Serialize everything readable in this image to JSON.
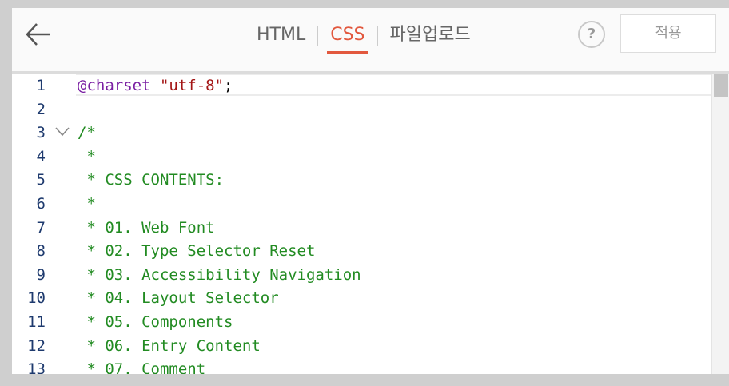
{
  "header": {
    "tabs": [
      {
        "label": "HTML",
        "active": false
      },
      {
        "label": "CSS",
        "active": true
      },
      {
        "label": "파일업로드",
        "active": false
      }
    ],
    "help_label": "?",
    "apply_label": "적용"
  },
  "editor": {
    "lines": [
      {
        "n": "1",
        "parts": [
          {
            "t": "@charset",
            "c": "kw"
          },
          {
            "t": " ",
            "c": ""
          },
          {
            "t": "\"utf-8\"",
            "c": "str"
          },
          {
            "t": ";",
            "c": ""
          }
        ]
      },
      {
        "n": "2",
        "parts": []
      },
      {
        "n": "3",
        "parts": [
          {
            "t": "/*",
            "c": "comment"
          }
        ]
      },
      {
        "n": "4",
        "parts": [
          {
            "t": " *",
            "c": "comment"
          }
        ]
      },
      {
        "n": "5",
        "parts": [
          {
            "t": " * CSS CONTENTS:",
            "c": "comment"
          }
        ]
      },
      {
        "n": "6",
        "parts": [
          {
            "t": " *",
            "c": "comment"
          }
        ]
      },
      {
        "n": "7",
        "parts": [
          {
            "t": " * 01. Web Font",
            "c": "comment"
          }
        ]
      },
      {
        "n": "8",
        "parts": [
          {
            "t": " * 02. Type Selector Reset",
            "c": "comment"
          }
        ]
      },
      {
        "n": "9",
        "parts": [
          {
            "t": " * 03. Accessibility Navigation",
            "c": "comment"
          }
        ]
      },
      {
        "n": "10",
        "parts": [
          {
            "t": " * 04. Layout Selector",
            "c": "comment"
          }
        ]
      },
      {
        "n": "11",
        "parts": [
          {
            "t": " * 05. Components",
            "c": "comment"
          }
        ]
      },
      {
        "n": "12",
        "parts": [
          {
            "t": " * 06. Entry Content",
            "c": "comment"
          }
        ]
      },
      {
        "n": "13",
        "parts": [
          {
            "t": " * 07. Comment",
            "c": "comment"
          }
        ]
      }
    ],
    "fold_line": "3",
    "active_line": "1"
  },
  "colors": {
    "accent": "#e2583e",
    "line_number": "#1e3a6e",
    "keyword": "#7a1fa2",
    "string": "#a31515",
    "comment": "#228b22"
  },
  "icons": {
    "back": "arrow-left-icon",
    "fold": "chevron-down-icon"
  }
}
